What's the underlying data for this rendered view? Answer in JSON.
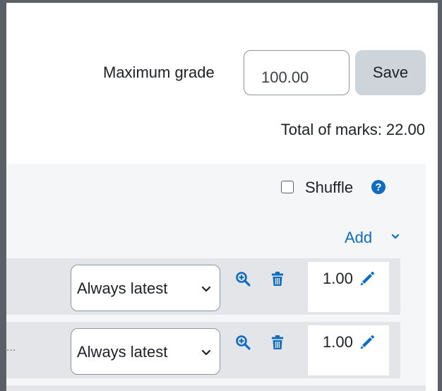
{
  "quiz": {
    "max_grade_label": "Maximum grade",
    "max_grade_value": "100.00",
    "save_label": "Save",
    "total_marks": "Total of marks: 22.00"
  },
  "section": {
    "shuffle_label": "Shuffle",
    "shuffle_checked": false,
    "help_glyph": "?",
    "add_label": "Add"
  },
  "slots": [
    {
      "ellipsis": "",
      "version": "Always latest",
      "mark": "1.00"
    },
    {
      "ellipsis": "...",
      "version": "Always latest",
      "mark": "1.00"
    }
  ],
  "icons": {
    "preview": "magnifier-plus-icon",
    "delete": "trash-icon",
    "edit": "pencil-icon",
    "help": "question-circle-icon",
    "chevron": "chevron-down-icon"
  },
  "colors": {
    "accent": "#0f6cbf",
    "button_secondary": "#ced4da",
    "row_bg": "#e3e5e8",
    "panel_bg": "#f5f6f7",
    "frame": "#5a6066"
  }
}
